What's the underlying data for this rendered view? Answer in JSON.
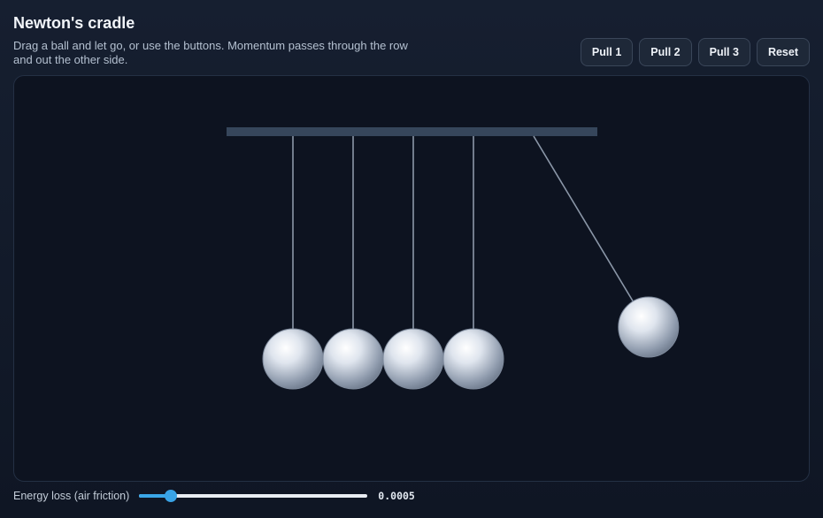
{
  "header": {
    "title": "Newton's cradle",
    "subtitle": "Drag a ball and let go, or use the buttons. Momentum passes through the row and out the other side."
  },
  "toolbar": {
    "buttons": [
      {
        "label": "Pull 1"
      },
      {
        "label": "Pull 2"
      },
      {
        "label": "Pull 3"
      },
      {
        "label": "Reset"
      }
    ]
  },
  "cradle": {
    "ball_count": 5,
    "ball_angles_deg": [
      0,
      0,
      0,
      0,
      31
    ]
  },
  "controls": {
    "friction_label": "Energy loss (air friction)",
    "friction_fraction": 0.14,
    "friction_value": "0.0005"
  },
  "colors": {
    "accent": "#39a3e6",
    "bar": "#36465b",
    "string": "#8b97a8"
  }
}
